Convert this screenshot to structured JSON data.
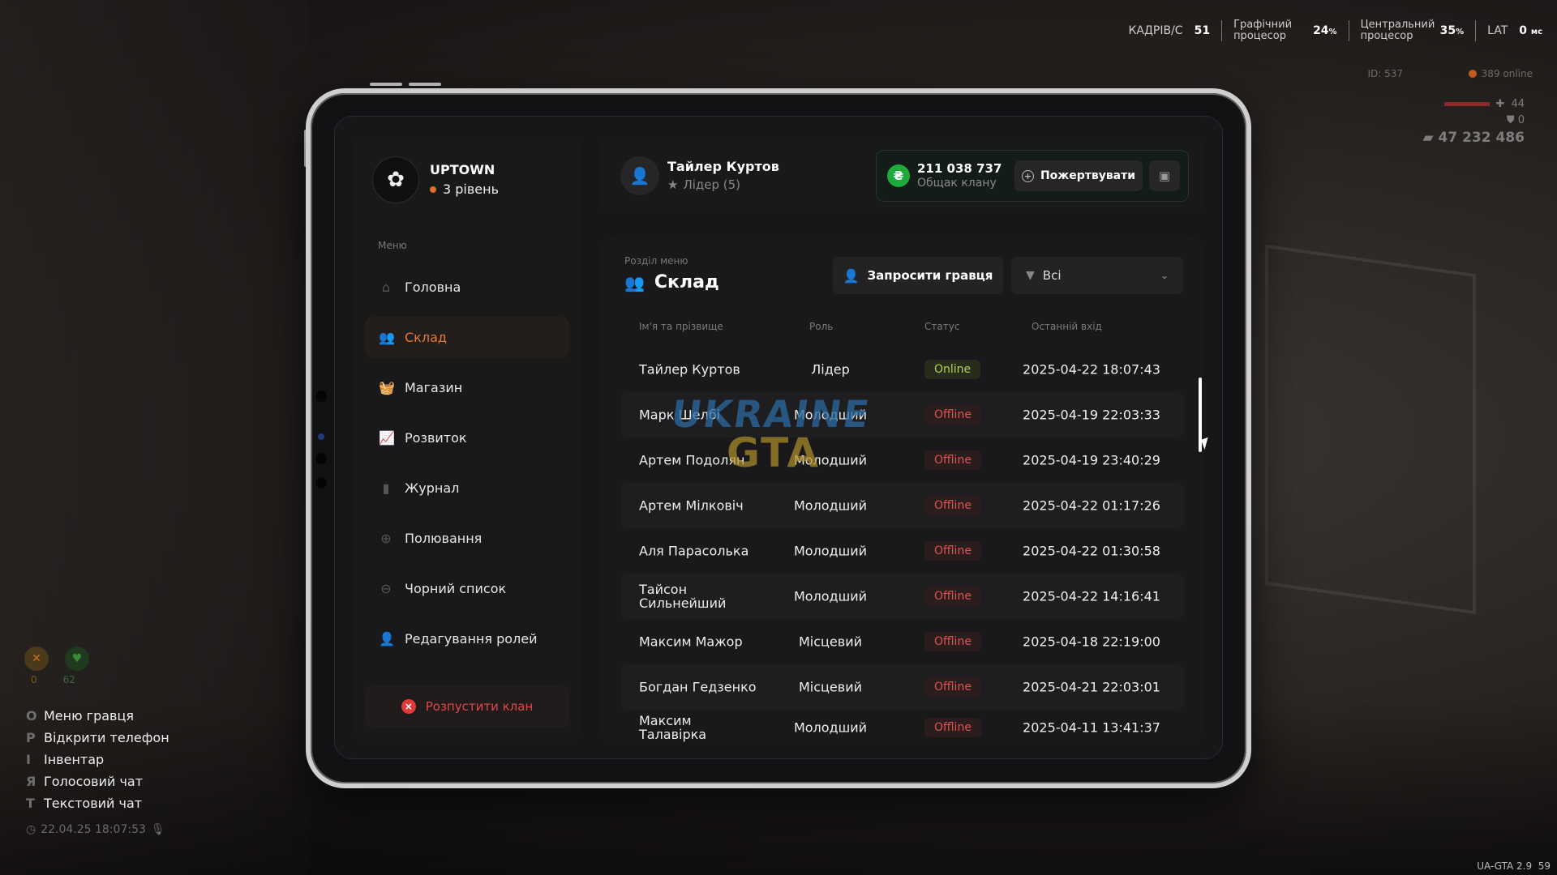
{
  "hud": {
    "fps_label": "КАДРІВ/С",
    "fps_value": "51",
    "gpu_label": "Графічний процесор",
    "gpu_value": "24",
    "gpu_unit": "%",
    "cpu_label": "Центральний процесор",
    "cpu_value": "35",
    "cpu_unit": "%",
    "lat_label": "LAT",
    "lat_value": "0",
    "lat_unit": "мс",
    "player_id": "ID: 537",
    "online": "389 online",
    "health": "44",
    "armor": "0",
    "money": "47 232 486",
    "food": "0",
    "water": "62",
    "keys": [
      {
        "key": "O",
        "label": "Меню гравця"
      },
      {
        "key": "P",
        "label": "Відкрити телефон"
      },
      {
        "key": "I",
        "label": "Інвентар"
      },
      {
        "key": "Я",
        "label": "Голосовий чат"
      },
      {
        "key": "T",
        "label": "Текстовий чат"
      }
    ],
    "datetime": "22.04.25 18:07:53",
    "version": "UA-GTA 2.9",
    "version_num": "59"
  },
  "clan": {
    "name": "UPTOWN",
    "level": "3 рівень"
  },
  "menu": {
    "caption": "Меню",
    "items": [
      {
        "label": "Головна",
        "icon": "home-icon"
      },
      {
        "label": "Склад",
        "icon": "users-icon"
      },
      {
        "label": "Магазин",
        "icon": "basket-icon"
      },
      {
        "label": "Розвиток",
        "icon": "chart-icon"
      },
      {
        "label": "Журнал",
        "icon": "book-icon"
      },
      {
        "label": "Полювання",
        "icon": "crosshair-icon"
      },
      {
        "label": "Чорний список",
        "icon": "block-icon"
      },
      {
        "label": "Редагування ролей",
        "icon": "user-edit-icon"
      }
    ],
    "dissolve_label": "Розпустити клан"
  },
  "user": {
    "name": "Тайлер Куртов",
    "role": "Лідер (5)"
  },
  "bank": {
    "amount": "211 038 737",
    "label": "Общак клану",
    "donate_label": "Пожертвувати"
  },
  "section": {
    "caption": "Розділ меню",
    "title": "Склад",
    "invite_label": "Запросити гравця",
    "filter_value": "Всі"
  },
  "table": {
    "headers": {
      "name": "Ім'я та прізвище",
      "role": "Роль",
      "status": "Статус",
      "last_login": "Останній вхід"
    },
    "rows": [
      {
        "name": "Тайлер Куртов",
        "role": "Лідер",
        "status": "Online",
        "last_login": "2025-04-22 18:07:43"
      },
      {
        "name": "Марк Шелбі",
        "role": "Молодший",
        "status": "Offline",
        "last_login": "2025-04-19 22:03:33"
      },
      {
        "name": "Артем Подолян",
        "role": "Молодший",
        "status": "Offline",
        "last_login": "2025-04-19 23:40:29"
      },
      {
        "name": "Артем Мілковіч",
        "role": "Молодший",
        "status": "Offline",
        "last_login": "2025-04-22 01:17:26"
      },
      {
        "name": "Аля Парасолька",
        "role": "Молодший",
        "status": "Offline",
        "last_login": "2025-04-22 01:30:58"
      },
      {
        "name": "Тайсон Сильнейший",
        "role": "Молодший",
        "status": "Offline",
        "last_login": "2025-04-22 14:16:41"
      },
      {
        "name": "Максим Мажор",
        "role": "Місцевий",
        "status": "Offline",
        "last_login": "2025-04-18 22:19:00"
      },
      {
        "name": "Богдан Гедзенко",
        "role": "Місцевий",
        "status": "Offline",
        "last_login": "2025-04-21 22:03:01"
      },
      {
        "name": "Максим Талавірка",
        "role": "Молодший",
        "status": "Offline",
        "last_login": "2025-04-11 13:41:37"
      }
    ]
  },
  "watermark": {
    "line1": "UKRAINE",
    "line2": "GTA"
  },
  "colors": {
    "accent": "#e37a35",
    "online": "#b8d24a",
    "offline": "#e25151",
    "bank_green": "#1eaa3c"
  }
}
